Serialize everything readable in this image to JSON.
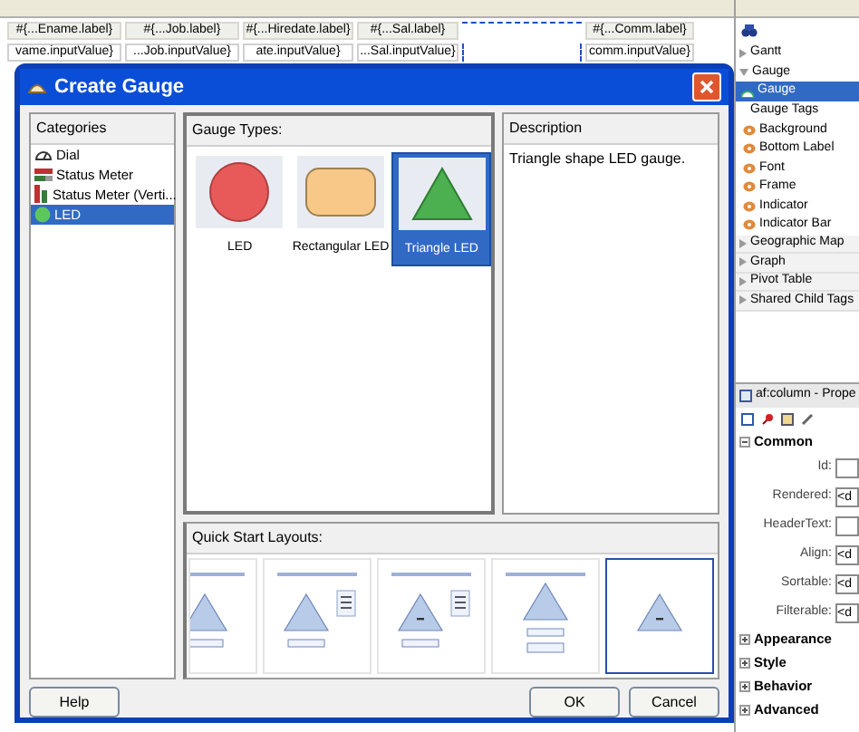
{
  "editor": {
    "columns": [
      {
        "header": "#{...Ename.label}",
        "value": "vame.inputValue}",
        "selected": false
      },
      {
        "header": "#{...Job.label}",
        "value": "...Job.inputValue}",
        "selected": false
      },
      {
        "header": "#{...Hiredate.label}",
        "value": "ate.inputValue}",
        "selected": false
      },
      {
        "header": "#{...Sal.label}",
        "value": "...Sal.inputValue}",
        "selected": false
      },
      {
        "selected": true
      },
      {
        "header": "#{...Comm.label}",
        "value": "comm.inputValue}",
        "selected": false
      }
    ]
  },
  "dialog": {
    "title": "Create Gauge",
    "categories": {
      "heading": "Categories",
      "items": [
        {
          "label": "Dial",
          "kind": "dial",
          "selected": false
        },
        {
          "label": "Status Meter",
          "kind": "meter",
          "selected": false
        },
        {
          "label": "Status Meter (Verti...",
          "kind": "vmeter",
          "selected": false
        },
        {
          "label": "LED",
          "kind": "led",
          "selected": true
        }
      ]
    },
    "gauge_types": {
      "heading": "Gauge Types:",
      "items": [
        {
          "label": "LED",
          "kind": "circle",
          "selected": false
        },
        {
          "label": "Rectangular LED",
          "kind": "rect",
          "selected": false
        },
        {
          "label": "Triangle LED",
          "kind": "triangle",
          "selected": true
        }
      ]
    },
    "description": {
      "heading": "Description",
      "text": "Triangle shape LED gauge."
    },
    "quick_start": {
      "heading": "Quick Start Layouts:",
      "layouts": [
        {
          "kind": "bottom",
          "selected": false
        },
        {
          "kind": "legend",
          "selected": false
        },
        {
          "kind": "legend_center",
          "selected": false
        },
        {
          "kind": "stacked",
          "selected": false
        },
        {
          "kind": "plain",
          "selected": true
        }
      ]
    },
    "buttons": [
      {
        "label": "Help",
        "kind": "left"
      },
      {
        "label": "OK",
        "kind": "right"
      },
      {
        "label": "Cancel",
        "kind": "right"
      }
    ]
  },
  "palette": {
    "items": [
      {
        "label": "Gantt",
        "kind": "group",
        "expanded": false
      },
      {
        "label": "Gauge",
        "kind": "group",
        "expanded": true
      },
      {
        "label": "Gauge",
        "kind": "item",
        "selected": true
      },
      {
        "label": "Gauge Tags",
        "kind": "section"
      },
      {
        "label": "Background",
        "kind": "tag"
      },
      {
        "label": "Bottom Label",
        "kind": "tag"
      },
      {
        "label": "Font",
        "kind": "tag"
      },
      {
        "label": "Frame",
        "kind": "tag"
      },
      {
        "label": "Indicator",
        "kind": "tag"
      },
      {
        "label": "Indicator Bar",
        "kind": "tag"
      },
      {
        "label": "Geographic Map",
        "kind": "group",
        "expanded": false
      },
      {
        "label": "Graph",
        "kind": "group",
        "expanded": false
      },
      {
        "label": "Pivot Table",
        "kind": "group",
        "expanded": false
      },
      {
        "label": "Shared Child Tags",
        "kind": "group",
        "expanded": false
      }
    ]
  },
  "properties": {
    "title": "af:column - Prope",
    "sections": [
      {
        "label": "Common",
        "expanded": true,
        "fields": [
          {
            "label": "Id:"
          },
          {
            "label": "Rendered:",
            "value": "<d"
          },
          {
            "label": "HeaderText:"
          },
          {
            "label": "Align:",
            "value": "<d"
          },
          {
            "label": "Sortable:",
            "value": "<d"
          },
          {
            "label": "Filterable:",
            "value": "<d"
          }
        ]
      },
      {
        "label": "Appearance",
        "expanded": false
      },
      {
        "label": "Style",
        "expanded": false
      },
      {
        "label": "Behavior",
        "expanded": false
      },
      {
        "label": "Advanced",
        "expanded": false
      }
    ]
  }
}
